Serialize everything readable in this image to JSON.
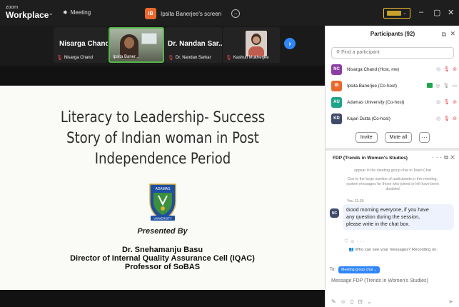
{
  "titlebar": {
    "brand_line1": "zoom",
    "brand_line2": "Workplace",
    "meeting_label": "Meeting",
    "share_initial": "IB",
    "share_label": "Ipsita Banerjee's screen",
    "window_controls": [
      "–",
      "▢",
      "✕"
    ]
  },
  "video_strip": {
    "tiles": [
      {
        "name": "Nisarga Chand",
        "label": "Nisarga Chand"
      },
      {
        "name": "",
        "label": "Ipsita Baner..."
      },
      {
        "name": "Dr. Nandan Sar...",
        "label": "Dr. Nandan Sarkar"
      },
      {
        "name": "",
        "label": "Kashuti Mukherjee"
      }
    ]
  },
  "slide": {
    "title_lines": [
      "Literacy to Leadership- Success",
      "Story of Indian woman in Post",
      "Independence Period"
    ],
    "crest_top_text": "ADAMAS",
    "crest_bottom_text": "UNIVERSITY",
    "presented_by": "Presented By",
    "presenter_name": "Dr. Snehamanju Basu",
    "presenter_role": "Director of Internal Quality Assurance Cell (IQAC)",
    "presenter_title": "Professor of SoBAS"
  },
  "participants": {
    "header": "Participants (92)",
    "search_placeholder": "Find a participant",
    "list": [
      {
        "initials": "NC",
        "name": "Nisarga Chand (Host, me)",
        "color": "#8b3fa3"
      },
      {
        "initials": "IB",
        "name": "Ipsita Banerjee (Co-host)",
        "color": "#e9692c"
      },
      {
        "initials": "AU",
        "name": "Adamas University (Co-host)",
        "color": "#1fa38a"
      },
      {
        "initials": "KD",
        "name": "Kajari Dutta (Co-host)",
        "color": "#3f4a6c"
      }
    ],
    "invite_label": "Invite",
    "mute_all_label": "Mute all",
    "more_label": "···"
  },
  "chat": {
    "title": "FDP (Trends in Women's Studies)",
    "sys_line1": "appear in the meeting group chat in Team Chat",
    "sys_line2": "Due to the large number of participants in this meeting,",
    "sys_line3": "system messages for those who joined or left have been",
    "sys_line4": "disabled",
    "sender_time": "You 11:36",
    "sender_initials": "NC",
    "message_line1": "Good morning everyone, if you have",
    "message_line2": "any question during the session,",
    "message_line3": "please write in the chat box.",
    "who_can_see": "Who can see your messages? Recording on",
    "to_label": "To:",
    "to_chip": "Meeting group chat ⌄",
    "compose_placeholder": "Message FDP (Trends in Women's Studies)"
  }
}
